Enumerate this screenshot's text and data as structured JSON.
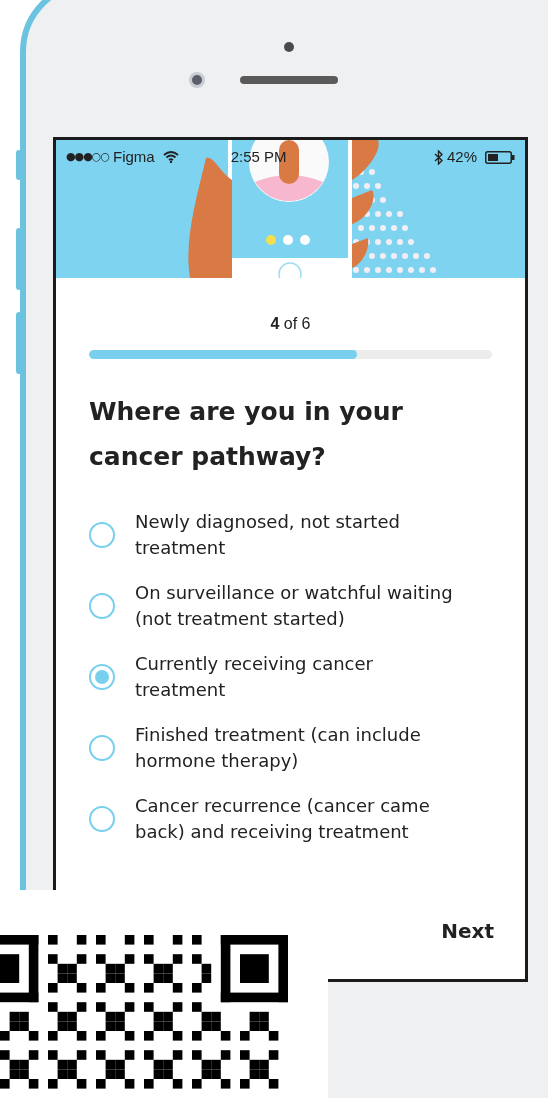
{
  "status_bar": {
    "signal": "●●●○○",
    "carrier": "Figma",
    "time": "2:55 PM",
    "battery": "42%"
  },
  "progress": {
    "label": "**4** of 6",
    "level": 0.665
  },
  "question": "Where are you in your cancer pathway?",
  "options": [
    {
      "label": "Newly diagnosed, not started treatment",
      "selected": false
    },
    {
      "label": "On surveillance or watchful waiting (not treatment started)",
      "selected": false
    },
    {
      "label": "Currently receiving cancer treatment",
      "selected": true
    },
    {
      "label": "Finished treatment (can include hormone therapy)",
      "selected": false
    },
    {
      "label": "Cancer recurrence (cancer came back) and receiving treatment",
      "selected": false
    }
  ],
  "next_button": "Next"
}
